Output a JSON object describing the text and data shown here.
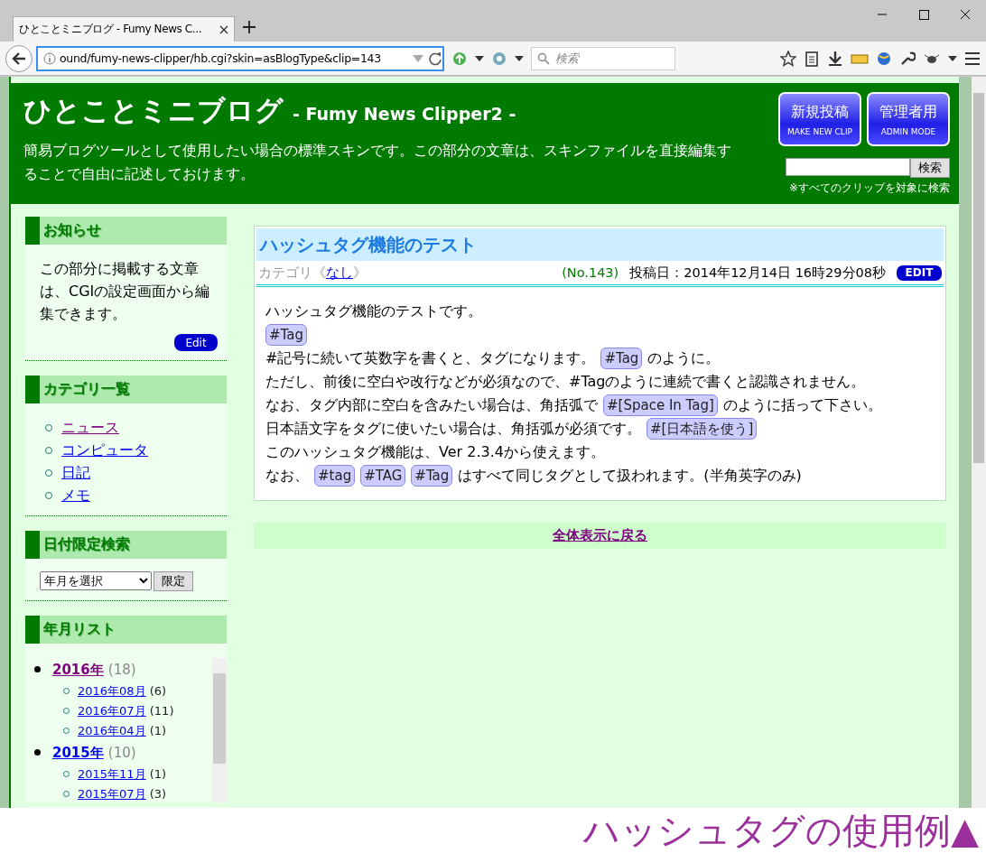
{
  "browser": {
    "tab_title": "ひとことミニブログ - Fumy News C...",
    "url": "ound/fumy-news-clipper/hb.cgi?skin=asBlogType&clip=143",
    "search_placeholder": "検索"
  },
  "header": {
    "title": "ひとことミニブログ",
    "subtitle": "- Fumy News Clipper2 -",
    "description": "簡易ブログツールとして使用したい場合の標準スキンです。この部分の文章は、スキンファイルを直接編集することで自由に記述しておけます。",
    "buttons": [
      {
        "label": "新規投稿",
        "sublabel": "MAKE NEW CLIP"
      },
      {
        "label": "管理者用",
        "sublabel": "ADMIN MODE"
      }
    ],
    "search_button": "検索",
    "search_note": "※すべてのクリップを対象に検索"
  },
  "sidebar": {
    "sections": [
      {
        "kind": "notice",
        "heading": "お知らせ",
        "text": "この部分に掲載する文章は、CGIの設定画面から編集できます。",
        "button": "Edit"
      },
      {
        "kind": "categories",
        "heading": "カテゴリ一覧",
        "links": [
          {
            "label": "ニュース",
            "visited": true
          },
          {
            "label": "コンピュータ",
            "visited": false
          },
          {
            "label": "日記",
            "visited": false
          },
          {
            "label": "メモ",
            "visited": false
          }
        ]
      },
      {
        "kind": "date_search",
        "heading": "日付限定検索",
        "select": "年月を選択",
        "button": "限定"
      },
      {
        "kind": "archive",
        "heading": "年月リスト",
        "years": [
          {
            "label": "2016年",
            "count": "(18)",
            "visited": true,
            "months": [
              {
                "label": "2016年08月",
                "count": "(6)"
              },
              {
                "label": "2016年07月",
                "count": "(11)"
              },
              {
                "label": "2016年04月",
                "count": "(1)"
              }
            ]
          },
          {
            "label": "2015年",
            "count": "(10)",
            "visited": false,
            "months": [
              {
                "label": "2015年11月",
                "count": "(1)"
              },
              {
                "label": "2015年07月",
                "count": "(3)"
              }
            ]
          }
        ]
      }
    ]
  },
  "post": {
    "title": "ハッシュタグ機能のテスト",
    "category_prefix": "カテゴリ《",
    "category": "なし",
    "category_suffix": "》",
    "number": "(No.143)",
    "date": "投稿日：2014年12月14日 16時29分08秒",
    "edit_button": "EDIT",
    "lines": [
      [
        {
          "kind": "text",
          "text": "ハッシュタグ機能のテストです。"
        }
      ],
      [
        {
          "kind": "tag",
          "text": "#Tag"
        }
      ],
      [
        {
          "kind": "text",
          "text": "#記号に続いて英数字を書くと、タグになります。"
        },
        {
          "kind": "tag",
          "text": "#Tag"
        },
        {
          "kind": "text",
          "text": "のように。"
        }
      ],
      [
        {
          "kind": "text",
          "text": "ただし、前後に空白や改行などが必須なので、#Tagのように連続で書くと認識されません。"
        }
      ],
      [
        {
          "kind": "text",
          "text": "なお、タグ内部に空白を含みたい場合は、角括弧で"
        },
        {
          "kind": "tag",
          "text": "#[Space In Tag]"
        },
        {
          "kind": "text",
          "text": "のように括って下さい。"
        }
      ],
      [
        {
          "kind": "text",
          "text": "日本語文字をタグに使いたい場合は、角括弧が必須です。"
        },
        {
          "kind": "tag",
          "text": "#[日本語を使う]"
        }
      ],
      [
        {
          "kind": "text",
          "text": "このハッシュタグ機能は、Ver 2.3.4から使えます。"
        }
      ],
      [
        {
          "kind": "text",
          "text": "なお、"
        },
        {
          "kind": "tag",
          "text": "#tag"
        },
        {
          "kind": "tag",
          "text": "#TAG"
        },
        {
          "kind": "tag",
          "text": "#Tag"
        },
        {
          "kind": "text",
          "text": "はすべて同じタグとして扱われます。(半角英字のみ)"
        }
      ]
    ],
    "back_link": "全体表示に戻る"
  },
  "caption": "ハッシュタグの使用例▲"
}
